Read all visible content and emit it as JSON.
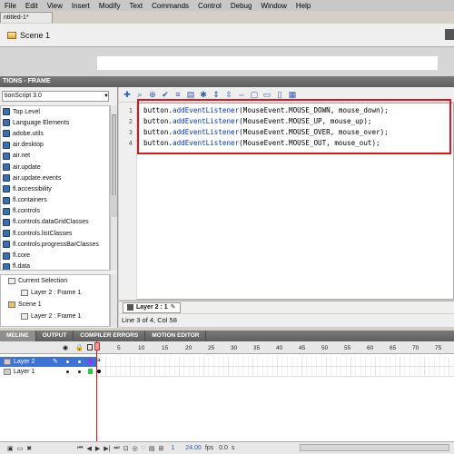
{
  "menubar": {
    "items": [
      "File",
      "Edit",
      "View",
      "Insert",
      "Modify",
      "Text",
      "Commands",
      "Control",
      "Debug",
      "Window",
      "Help"
    ]
  },
  "document_tab": "ntitled-1*",
  "edit_bar": {
    "scene_label": "Scene 1"
  },
  "actions_panel": {
    "title": "TIONS - FRAME",
    "language_select": "tionScript 3.0",
    "toolbox_items": [
      "Top Level",
      "Language Elements",
      "adobe.utils",
      "air.desktop",
      "air.net",
      "air.update",
      "air.update.events",
      "fl.accessibility",
      "fl.containers",
      "fl.controls",
      "fl.controls.dataGridClasses",
      "fl.controls.listClasses",
      "fl.controls.progressBarClasses",
      "fl.core",
      "fl.data"
    ],
    "script_navigator": [
      {
        "label": "Current Selection",
        "icon": "selection-icon"
      },
      {
        "label": "Layer 2 : Frame 1",
        "icon": "frame-icon"
      },
      {
        "label": "Scene 1",
        "icon": "scene-icon"
      },
      {
        "label": "Layer 2 : Frame 1",
        "icon": "frame-icon"
      }
    ],
    "toolbar_icons": [
      "add-icon",
      "find-icon",
      "target-icon",
      "check-syntax-icon",
      "auto-format-icon",
      "code-hint-icon",
      "debug-icon",
      "collapse-icon",
      "collapse-selection-icon",
      "expand-icon",
      "comment-block-icon",
      "comment-line-icon",
      "uncomment-icon",
      "show-toolbox-icon"
    ],
    "code_lines": [
      {
        "n": "1",
        "obj": "button.",
        "method": "addEventListener",
        "args": "(MouseEvent.MOUSE_DOWN, mouse_down);"
      },
      {
        "n": "2",
        "obj": "button.",
        "method": "addEventListener",
        "args": "(MouseEvent.MOUSE_UP, mouse_up);"
      },
      {
        "n": "3",
        "obj": "button.",
        "method": "addEventListener",
        "args": "(MouseEvent.MOUSE_OVER, mouse_over);"
      },
      {
        "n": "4",
        "obj": "button.",
        "method": "addEventListener",
        "args": "(MouseEvent.MOUSE_OUT, mouse_out);"
      }
    ],
    "editor_tab": "Layer 2 : 1",
    "status": "Line 3 of 4, Col 58"
  },
  "timeline": {
    "tabs": [
      "MELINE",
      "OUTPUT",
      "COMPILER ERRORS",
      "MOTION EDITOR"
    ],
    "ruler": [
      "5",
      "10",
      "15",
      "20",
      "25",
      "30",
      "35",
      "40",
      "45",
      "50",
      "55",
      "60",
      "65",
      "70",
      "75",
      "80"
    ],
    "layers": [
      {
        "name": "Layer 2",
        "selected": true,
        "color": "#8a3df0"
      },
      {
        "name": "Layer 1",
        "selected": false,
        "color": "#27c93f"
      }
    ],
    "footer": {
      "frame": "1",
      "fps": "24.00",
      "fps_unit": "fps",
      "time": "0.0",
      "time_unit": "s"
    }
  },
  "colors": {
    "highlight": "#e0141c",
    "selection": "#3d73d4",
    "playhead": "#d31818"
  }
}
